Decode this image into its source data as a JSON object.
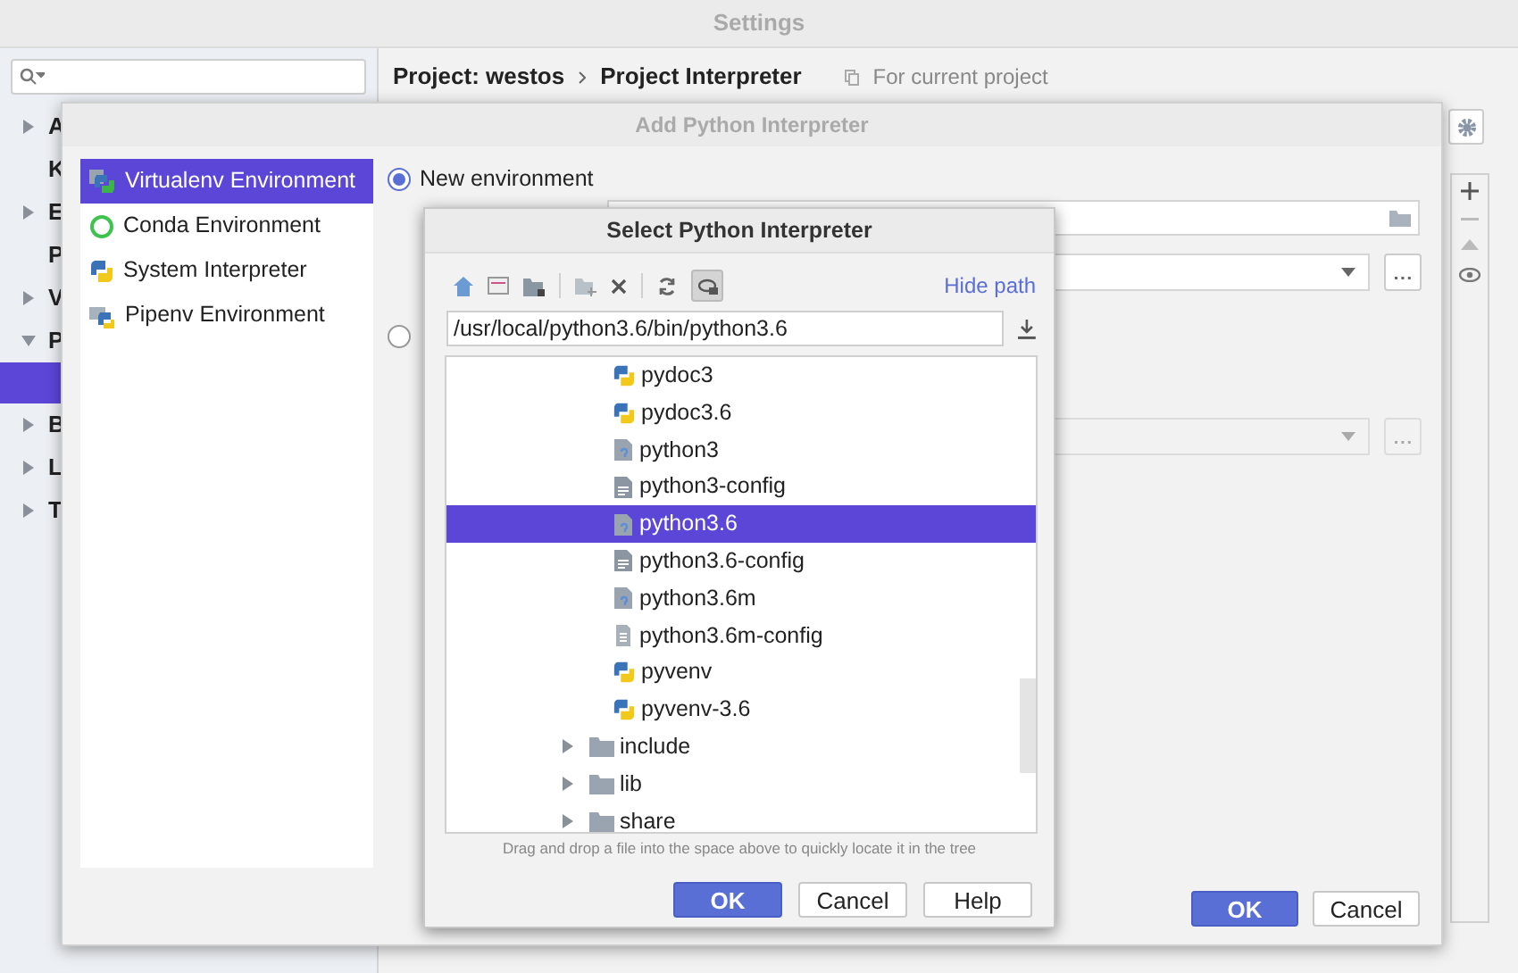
{
  "window": {
    "title": "Settings"
  },
  "sidebar": {
    "items": [
      {
        "label": "A",
        "expanded": false
      },
      {
        "label": "K"
      },
      {
        "label": "E",
        "expanded": false
      },
      {
        "label": "P"
      },
      {
        "label": "V",
        "expanded": false
      },
      {
        "label": "P",
        "expanded": true,
        "children": [
          {
            "selected": true
          }
        ]
      },
      {
        "label": "B",
        "expanded": false
      },
      {
        "label": "L",
        "expanded": false
      },
      {
        "label": "T",
        "expanded": false
      }
    ]
  },
  "breadcrumb": [
    "Project: westos",
    "Project Interpreter"
  ],
  "scope_note": "For current project",
  "add_dialog": {
    "title": "Add Python Interpreter",
    "env_types": [
      {
        "label": "Virtualenv Environment",
        "kind": "virtualenv",
        "selected": true
      },
      {
        "label": "Conda Environment",
        "kind": "conda",
        "selected": false
      },
      {
        "label": "System Interpreter",
        "kind": "system",
        "selected": false
      },
      {
        "label": "Pipenv Environment",
        "kind": "pipenv",
        "selected": false
      }
    ],
    "options": [
      {
        "label": "New environment",
        "selected": true
      },
      {
        "selected": false
      }
    ],
    "buttons": [
      {
        "label": "OK",
        "primary": true
      },
      {
        "label": "Cancel",
        "primary": false
      }
    ]
  },
  "select_dialog": {
    "title": "Select Python Interpreter",
    "hide_path": "Hide path",
    "path": "/usr/local/python3.6/bin/python3.6",
    "tree": [
      {
        "label": "pydoc3",
        "kind": "python-script",
        "selected": false
      },
      {
        "label": "pydoc3.6",
        "kind": "python-script",
        "selected": false
      },
      {
        "label": "python3",
        "kind": "binary",
        "selected": false
      },
      {
        "label": "python3-config",
        "kind": "shell-script",
        "selected": false
      },
      {
        "label": "python3.6",
        "kind": "binary",
        "selected": true
      },
      {
        "label": "python3.6-config",
        "kind": "shell-script",
        "selected": false
      },
      {
        "label": "python3.6m",
        "kind": "binary",
        "selected": false
      },
      {
        "label": "python3.6m-config",
        "kind": "text-file",
        "selected": false
      },
      {
        "label": "pyvenv",
        "kind": "python-script",
        "selected": false
      },
      {
        "label": "pyvenv-3.6",
        "kind": "python-script",
        "selected": false
      },
      {
        "label": "include",
        "kind": "folder",
        "selected": false
      },
      {
        "label": "lib",
        "kind": "folder",
        "selected": false
      },
      {
        "label": "share",
        "kind": "folder",
        "selected": false
      }
    ],
    "hint": "Drag and drop a file into the space above to quickly locate it in the tree",
    "buttons": [
      {
        "label": "OK",
        "primary": true
      },
      {
        "label": "Cancel",
        "primary": false
      },
      {
        "label": "Help",
        "primary": false
      }
    ]
  }
}
